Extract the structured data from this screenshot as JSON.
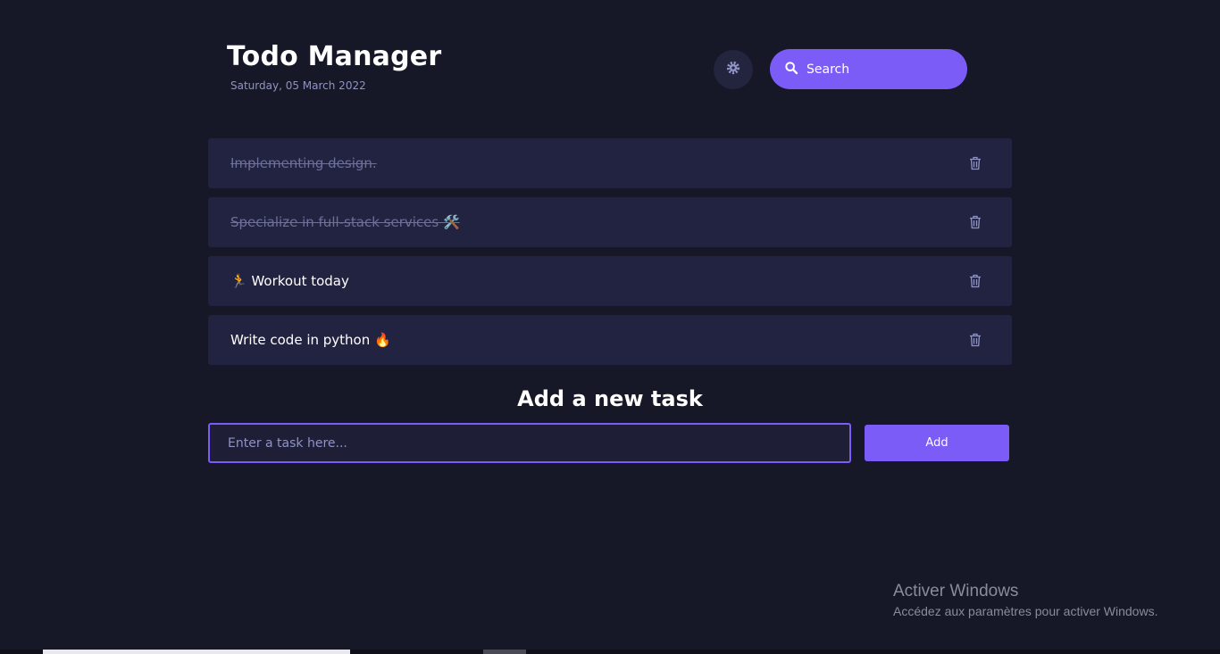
{
  "header": {
    "title": "Todo Manager",
    "date": "Saturday, 05 March 2022",
    "theme_toggle_icon": "gear-icon",
    "search": {
      "label": "Search",
      "icon": "search-icon"
    }
  },
  "tasks": [
    {
      "text": "Implementing design.",
      "completed": true
    },
    {
      "text": "Specialize in full-stack services 🛠️",
      "completed": true
    },
    {
      "text": "🏃 Workout today",
      "completed": false
    },
    {
      "text": "Write code in python 🔥",
      "completed": false
    }
  ],
  "task_action_icon": "trash-icon",
  "add_section": {
    "heading": "Add a new task",
    "input_placeholder": "Enter a task here...",
    "add_label": "Add"
  },
  "watermark": {
    "title": "Activer Windows",
    "subtitle": "Accédez aux paramètres pour activer Windows."
  },
  "colors": {
    "background": "#161727",
    "card": "#222341",
    "accent": "#7b5cf6",
    "muted_text": "#8f93c6",
    "completed_text": "#6d6f9c"
  }
}
